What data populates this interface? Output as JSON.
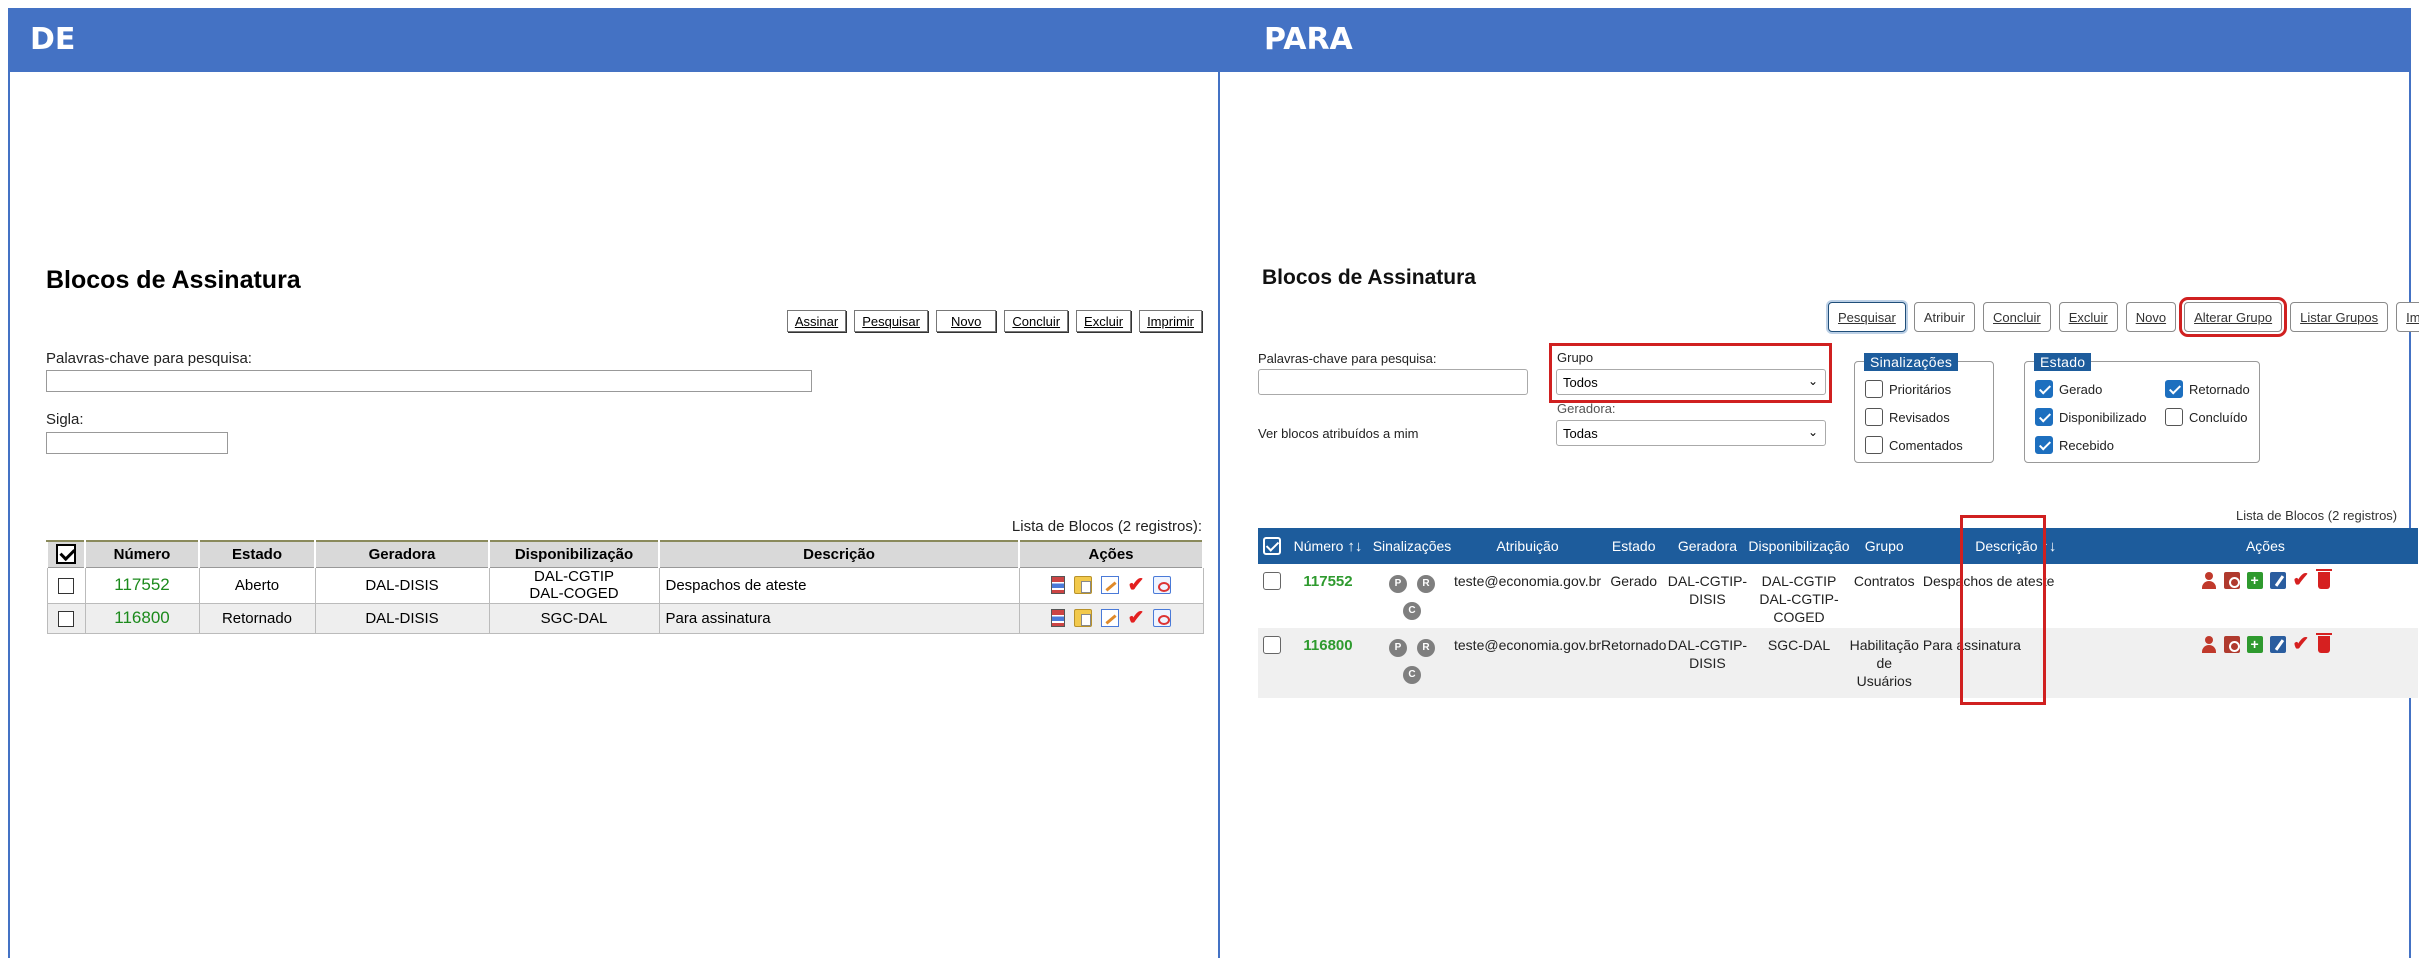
{
  "de": {
    "header": "DE",
    "title": "Blocos de Assinatura",
    "toolbar": [
      "Assinar",
      "Pesquisar",
      "Novo",
      "Concluir",
      "Excluir",
      "Imprimir"
    ],
    "keywords_label": "Palavras-chave para pesquisa:",
    "sigla_label": "Sigla:",
    "caption": "Lista de Blocos (2 registros):",
    "columns": [
      "Número",
      "Estado",
      "Geradora",
      "Disponibilização",
      "Descrição",
      "Ações"
    ],
    "rows": [
      {
        "numero": "117552",
        "estado": "Aberto",
        "geradora": "DAL-DISIS",
        "disp1": "DAL-CGTIP",
        "disp2": "DAL-COGED",
        "descricao": "Despachos de ateste"
      },
      {
        "numero": "116800",
        "estado": "Retornado",
        "geradora": "DAL-DISIS",
        "disp1": "SGC-DAL",
        "disp2": "",
        "descricao": "Para assinatura"
      }
    ]
  },
  "para": {
    "header": "PARA",
    "title": "Blocos de Assinatura",
    "toolbar": [
      "Pesquisar",
      "Atribuir",
      "Concluir",
      "Excluir",
      "Novo",
      "Alterar Grupo",
      "Listar Grupos",
      "Imprimir"
    ],
    "keywords_label": "Palavras-chave para pesquisa:",
    "assigned_label": "Ver blocos atribuídos a mim",
    "grupo_label": "Grupo",
    "grupo_value": "Todos",
    "geradora_label": "Geradora:",
    "geradora_value": "Todas",
    "sinalizacoes": {
      "legend": "Sinalizações",
      "options": [
        "Prioritários",
        "Revisados",
        "Comentados"
      ]
    },
    "estado": {
      "legend": "Estado",
      "options": [
        {
          "label": "Gerado",
          "checked": true
        },
        {
          "label": "Retornado",
          "checked": true
        },
        {
          "label": "Disponibilizado",
          "checked": true
        },
        {
          "label": "Concluído",
          "checked": false
        },
        {
          "label": "Recebido",
          "checked": true
        }
      ]
    },
    "caption": "Lista de Blocos (2 registros)",
    "columns": [
      "Número",
      "Sinalizações",
      "Atribuição",
      "Estado",
      "Geradora",
      "Disponibilização",
      "Grupo",
      "Descrição",
      "Ações"
    ],
    "badges": [
      "P",
      "R",
      "C"
    ],
    "rows": [
      {
        "numero": "117552",
        "atribuicao": "teste@economia.gov.br",
        "estado": "Gerado",
        "geradora1": "DAL-CGTIP-",
        "geradora2": "DISIS",
        "disp1": "DAL-CGTIP",
        "disp2": "DAL-CGTIP-",
        "disp3": "COGED",
        "grupo1": "Contratos",
        "grupo2": "",
        "grupo3": "",
        "descricao": "Despachos de ateste"
      },
      {
        "numero": "116800",
        "atribuicao": "teste@economia.gov.br",
        "estado": "Retornado",
        "geradora1": "DAL-CGTIP-",
        "geradora2": "DISIS",
        "disp1": "SGC-DAL",
        "disp2": "",
        "disp3": "",
        "grupo1": "Habilitação",
        "grupo2": "de",
        "grupo3": "Usuários",
        "descricao": "Para assinatura"
      }
    ]
  }
}
